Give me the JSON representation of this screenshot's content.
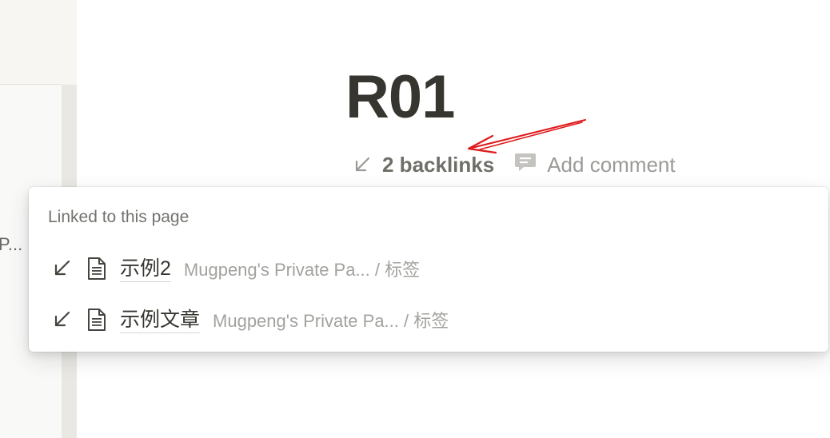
{
  "sidebar": {
    "truncated_item": "P..."
  },
  "page": {
    "title": "R01"
  },
  "meta": {
    "backlinks_label": "2 backlinks",
    "comment_label": "Add comment"
  },
  "popover": {
    "heading": "Linked to this page",
    "items": [
      {
        "title": "示例2",
        "path": "Mugpeng's Private Pa... / 标签"
      },
      {
        "title": "示例文章",
        "path": "Mugpeng's Private Pa... / 标签"
      }
    ]
  },
  "colors": {
    "annotation": "#e0191b",
    "text": "#37352f",
    "muted": "#9b9a97"
  },
  "icons": {
    "backlink": "arrow-down-left-icon",
    "comment": "comment-icon",
    "document": "document-icon"
  }
}
